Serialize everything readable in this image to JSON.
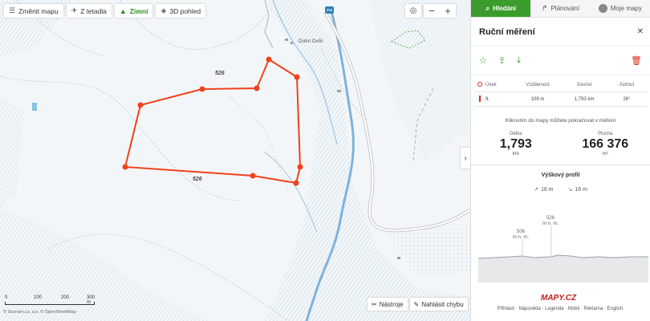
{
  "map": {
    "toolbar": [
      {
        "label": "Změnit mapu",
        "icon": "layers-icon"
      },
      {
        "label": "Z letadla",
        "icon": "plane-icon"
      },
      {
        "label": "Zimní",
        "icon": "mountain-icon",
        "active": true
      },
      {
        "label": "3D pohled",
        "icon": "cube-icon"
      }
    ],
    "zoom_in": "+",
    "zoom_out": "−",
    "locate_icon": "target-icon",
    "collapse": "›",
    "elevation_labels": [
      "526",
      "526"
    ],
    "village": "Dolní Dvůr",
    "road_badge": "296",
    "tools_label": "Nástroje",
    "report_label": "Nahlásit chybu",
    "scale_labels": [
      "0",
      "100",
      "200",
      "300 m"
    ],
    "copyright": "© Seznam.cz, a.s. © OpenStreetMap",
    "colors": {
      "route": "#f0421c",
      "water": "#7fb2dc"
    }
  },
  "panel": {
    "tabs": [
      {
        "label": "Hledání",
        "icon": "search-icon",
        "active": true
      },
      {
        "label": "Plánování",
        "icon": "route-icon"
      },
      {
        "label": "Moje mapy",
        "icon": "avatar"
      }
    ],
    "title": "Ruční měření",
    "close": "✕",
    "table": {
      "headers": [
        "Úsek",
        "Vzdálenost",
        "Součet",
        "Azimut"
      ],
      "rows": [
        {
          "segment": "9.",
          "distance": "109 m",
          "sum": "1,793 km",
          "azimuth": "26°"
        }
      ]
    },
    "hint": "Kliknutím do mapy můžete pokračovat v měření",
    "length": {
      "label": "Délka",
      "value": "1,793",
      "unit": "km"
    },
    "area": {
      "label": "Plocha",
      "value": "166 376",
      "unit": "m²"
    },
    "profile_title": "Výškový profil",
    "ascent": "16 m",
    "descent": "16 m",
    "profile_min": {
      "value": "506",
      "unit": "m n. m."
    },
    "profile_max": {
      "value": "526",
      "unit": "m n. m."
    },
    "logo": "MAPY.CZ",
    "footer": "Přihlásit · Nápověda · Legenda · Mobil · Reklama · English"
  }
}
